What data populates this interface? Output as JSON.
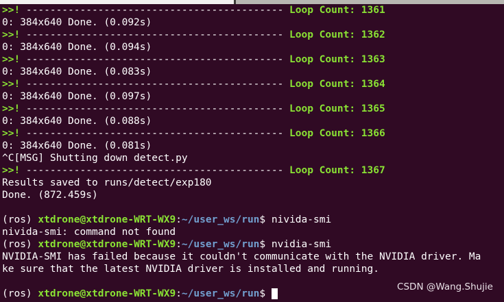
{
  "tabs": [
    "",
    ""
  ],
  "loop_prefix": ">>! ",
  "loop_dashes": "------------------------------------------- ",
  "loop_label": "Loop Count: ",
  "log": [
    {
      "loop": "1361",
      "done": "0: 384x640 Done. (0.092s)"
    },
    {
      "loop": "1362",
      "done": "0: 384x640 Done. (0.094s)"
    },
    {
      "loop": "1363",
      "done": "0: 384x640 Done. (0.083s)"
    },
    {
      "loop": "1364",
      "done": "0: 384x640 Done. (0.097s)"
    },
    {
      "loop": "1365",
      "done": "0: 384x640 Done. (0.088s)"
    },
    {
      "loop": "1366",
      "done": "0: 384x640 Done. (0.081s)"
    }
  ],
  "shutdown_msg": "^C[MSG] Shutting down detect.py",
  "last_loop": "1367",
  "results_saved": "Results saved to runs/detect/exp180",
  "total_done": "Done. (872.459s)",
  "prompt": {
    "env": "(ros) ",
    "user_host": "xtdrone@xtdrone-WRT-WX9",
    "colon": ":",
    "path": "~/user_ws/run",
    "dollar": "$ "
  },
  "commands": [
    {
      "cmd": "nivida-smi",
      "output": [
        "nivida-smi: command not found"
      ]
    },
    {
      "cmd": "nvidia-smi",
      "output": [
        "NVIDIA-SMI has failed because it couldn't communicate with the NVIDIA driver. Ma",
        "ke sure that the latest NVIDIA driver is installed and running."
      ]
    }
  ],
  "watermark": "CSDN @Wang.Shujie",
  "colors": {
    "background": "#300a24",
    "green": "#8ae234",
    "blue": "#729fcf"
  }
}
